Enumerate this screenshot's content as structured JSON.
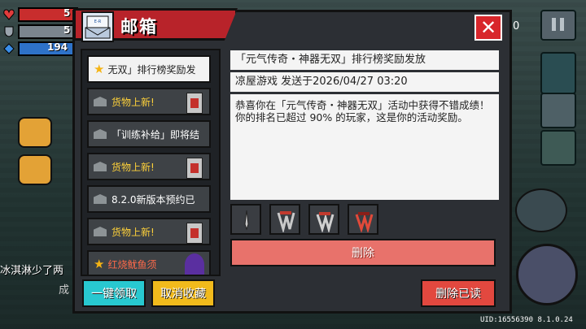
{
  "hud": {
    "hp": "5",
    "armor": "5",
    "energy": "194"
  },
  "mailbox": {
    "title": "邮箱",
    "icon_text": "E-R MAIL",
    "close_label": "✕",
    "items": [
      {
        "label": "无双」排行榜奖励发",
        "icon": "star-icon"
      },
      {
        "label": "货物上新!",
        "icon": "envelope-icon"
      },
      {
        "label": "「训练补给」即将结",
        "icon": "envelope-icon"
      },
      {
        "label": "货物上新!",
        "icon": "envelope-icon"
      },
      {
        "label": "8.2.0新版本预约已",
        "icon": "envelope-icon"
      },
      {
        "label": "货物上新!",
        "icon": "envelope-icon"
      },
      {
        "label": "红烧鱿鱼须",
        "icon": "star-icon"
      }
    ],
    "subject": "「元气传奇・神器无双」排行榜奖励发放",
    "sender": "凉屋游戏 发送于2026/04/27 03:20",
    "body": "恭喜你在「元气传奇・神器无双」活动中获得不错成绩！你的排名已超过 90% 的玩家，这是你的活动奖励。",
    "delete_label": "删除",
    "claim_all_label": "一键领取",
    "unfavorite_label": "取消收藏",
    "delete_read_label": "删除已读"
  },
  "background": {
    "chat_text": "冰淇淋少了两",
    "chat_text2": "成",
    "right_number": "0"
  },
  "footer": {
    "uid": "UID:16556390 8.1.0.24"
  },
  "colors": {
    "accent_red": "#b8232a",
    "cyan": "#28c8d0",
    "yellow": "#f1ba1c",
    "delete_red": "#e8726b"
  }
}
